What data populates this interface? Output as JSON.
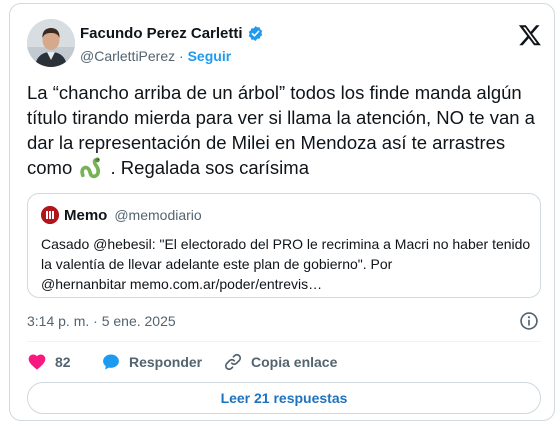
{
  "author": {
    "name": "Facundo Perez Carletti",
    "handle": "@CarlettiPerez",
    "separator": "·",
    "follow_label": "Seguir",
    "verified_color": "#1d9bf0"
  },
  "tweet": {
    "text_before_emoji": "La “chancho arriba de un árbol” todos los finde manda algún título tirando mierda para ver si llama la atención, NO te van a dar la representación de Milei en Mendoza así te arrastres como",
    "emoji_icon": "snake-emoji-icon",
    "text_after_emoji": ". Regalada sos carísima"
  },
  "quote": {
    "name": "Memo",
    "handle": "@memodiario",
    "text": "Casado @hebesil: \"El electorado del PRO le recrimina a Macri no haber tenido la valentía de llevar adelante este plan de gobierno\". Por\n@hernanbitar memo.com.ar/poder/entrevis…"
  },
  "meta": {
    "timestamp": "3:14 p. m. · 5 ene. 2025"
  },
  "actions": {
    "likes_count": "82",
    "reply_label": "Responder",
    "copy_link_label": "Copia enlace",
    "read_replies_label": "Leer 21 respuestas"
  },
  "colors": {
    "accent": "#1d9bf0",
    "like": "#f91880",
    "text_primary": "#0f1419",
    "text_secondary": "#536471",
    "border": "#cfd9de"
  }
}
